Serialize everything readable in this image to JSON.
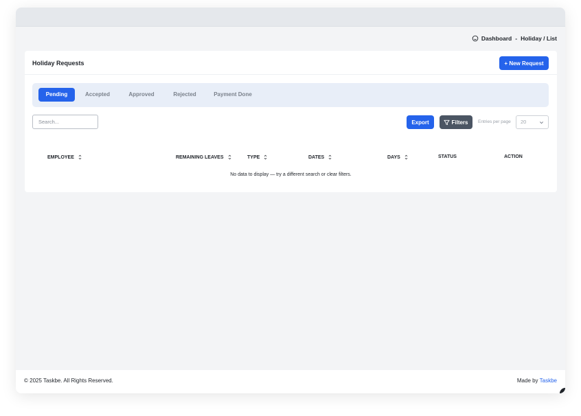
{
  "breadcrumb": {
    "home_icon": "home-icon",
    "root": "Dashboard",
    "separator": "-",
    "current": "Holiday / List"
  },
  "card": {
    "title": "Holiday Requests",
    "new_button": "+ New Request"
  },
  "tabs": [
    {
      "label": "Pending",
      "active": true
    },
    {
      "label": "Accepted",
      "active": false
    },
    {
      "label": "Approved",
      "active": false
    },
    {
      "label": "Rejected",
      "active": false
    },
    {
      "label": "Payment Done",
      "active": false
    }
  ],
  "toolbar": {
    "search_placeholder": "Search...",
    "export_label": "Export",
    "filters_label": "Filters",
    "filters_icon": "filter-icon",
    "entries_label": "Entries per page",
    "entries_value": "20"
  },
  "table": {
    "columns": [
      {
        "label": "EMPLOYEE",
        "sortable": true
      },
      {
        "label": "REMAINING LEAVES",
        "sortable": true
      },
      {
        "label": "TYPE",
        "sortable": true
      },
      {
        "label": "DATES",
        "sortable": true
      },
      {
        "label": "DAYS",
        "sortable": true
      },
      {
        "label": "STATUS",
        "sortable": false
      },
      {
        "label": "ACTION",
        "sortable": false
      }
    ],
    "empty_message": "No data to display — try a different search or clear filters."
  },
  "footer": {
    "copyright": "© 2025 Taskbe. All Rights Reserved.",
    "made_by_prefix": "Made by ",
    "made_by_link": "Taskbe"
  },
  "colors": {
    "primary": "#2563eb",
    "secondary_button": "#4b5563",
    "tab_bar_bg": "#e8eef8",
    "page_bg": "#f3f4f6"
  }
}
